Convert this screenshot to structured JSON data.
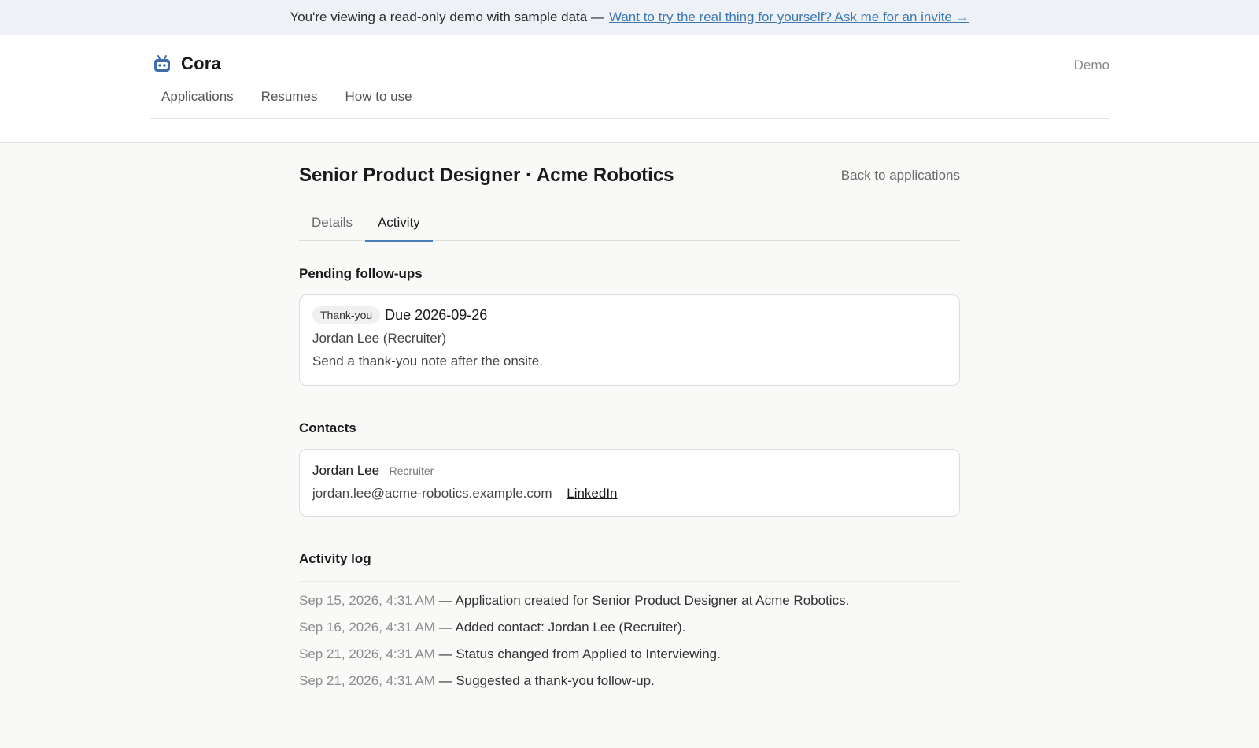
{
  "banner": {
    "text": "You're viewing a read-only demo with sample data —",
    "link": "Want to try the real thing for yourself? Ask me for an invite →"
  },
  "header": {
    "brand": "Cora",
    "demo_label": "Demo",
    "nav": [
      "Applications",
      "Resumes",
      "How to use"
    ]
  },
  "page": {
    "title": "Senior Product Designer · Acme Robotics",
    "back_link": "Back to applications",
    "tabs": [
      "Details",
      "Activity"
    ],
    "active_tab": "Activity"
  },
  "followups": {
    "heading": "Pending follow-ups",
    "items": [
      {
        "badge": "Thank-you",
        "due": "Due 2026-09-26",
        "contact": "Jordan Lee (Recruiter)",
        "note": "Send a thank-you note after the onsite."
      }
    ]
  },
  "contacts": {
    "heading": "Contacts",
    "items": [
      {
        "name": "Jordan Lee",
        "role": "Recruiter",
        "email": "jordan.lee@acme-robotics.example.com",
        "link": "LinkedIn"
      }
    ]
  },
  "activity_log": {
    "heading": "Activity log",
    "entries": [
      {
        "time": "Sep 15, 2026, 4:31 AM",
        "text": "— Application created for Senior Product Designer at Acme Robotics."
      },
      {
        "time": "Sep 16, 2026, 4:31 AM",
        "text": "— Added contact: Jordan Lee (Recruiter)."
      },
      {
        "time": "Sep 21, 2026, 4:31 AM",
        "text": "— Status changed from Applied to Interviewing."
      },
      {
        "time": "Sep 21, 2026, 4:31 AM",
        "text": "— Suggested a thank-you follow-up."
      }
    ]
  },
  "colors": {
    "accent": "#4a7fb7",
    "banner_link": "#3d78b0",
    "banner_bg": "#eef2f6",
    "page_bg": "#f9f9f8"
  },
  "icons": {
    "brand": "robot-icon"
  }
}
